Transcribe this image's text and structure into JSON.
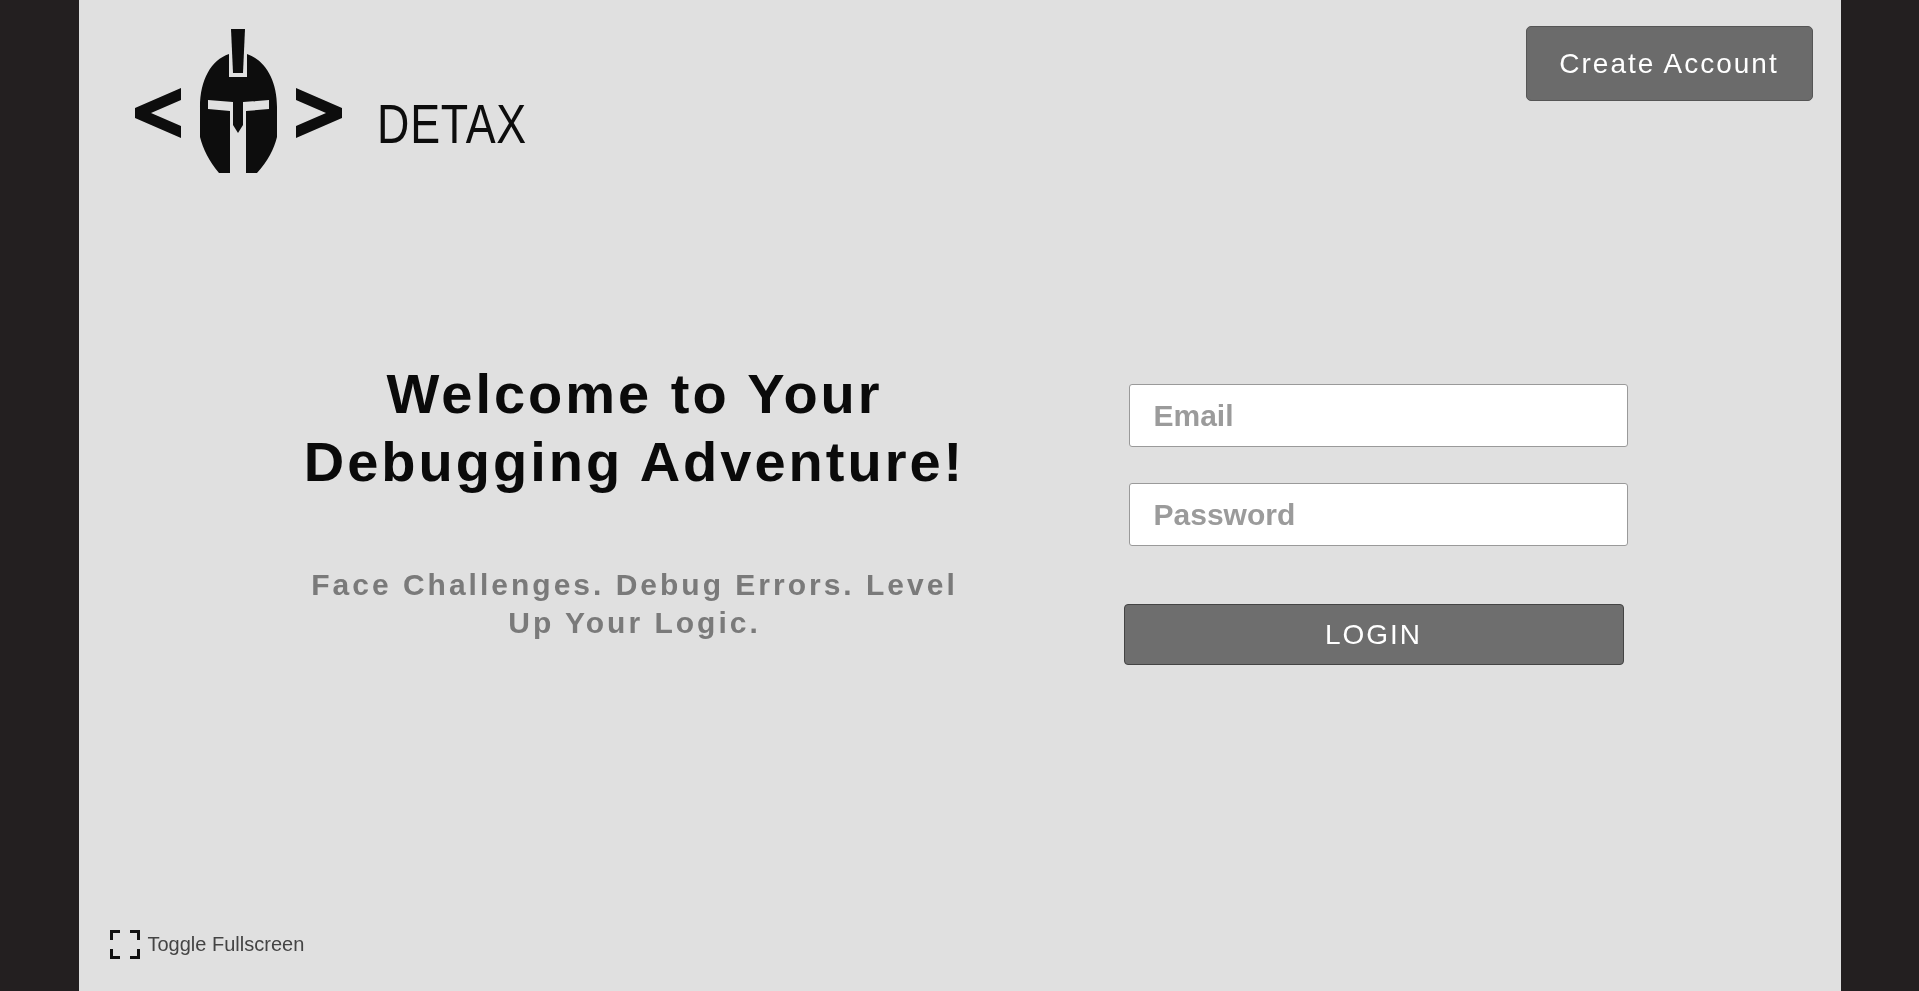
{
  "logo": {
    "brand": "DETAX"
  },
  "header": {
    "create_account_button": "Create Account"
  },
  "hero": {
    "title": "Welcome to Your Debugging Adventure!",
    "subtitle": "Face Challenges. Debug Errors. Level Up Your Logic."
  },
  "login_form": {
    "fields": [
      {
        "placeholder": "Email"
      },
      {
        "placeholder": "Password"
      }
    ],
    "submit_button": "LOGIN"
  },
  "footer": {
    "fullscreen_toggle": "Toggle Fullscreen"
  }
}
